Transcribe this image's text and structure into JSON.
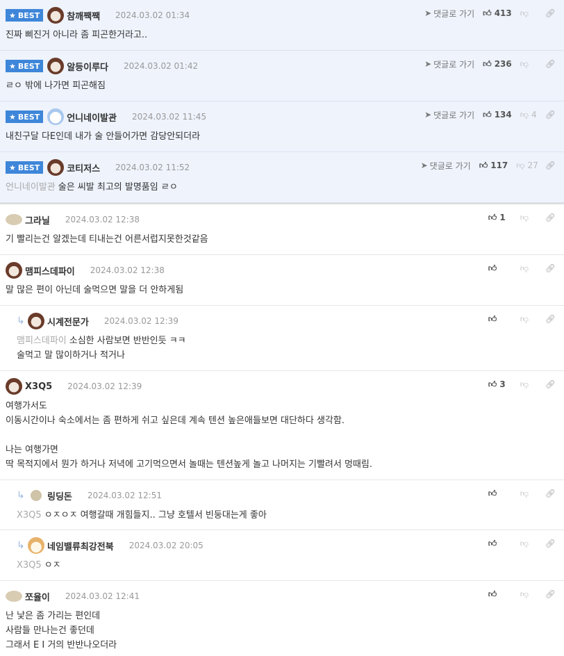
{
  "labels": {
    "best": "BEST",
    "goto_reply": "댓글로 가기"
  },
  "comments": [
    {
      "best": true,
      "nick": "참깨짹짹",
      "date": "2024.03.02 01:34",
      "likes": "413",
      "dislikes": "",
      "text": "진짜 삐진거 아니라 좀 피곤한거라고.."
    },
    {
      "best": true,
      "nick": "알등이루다",
      "date": "2024.03.02 01:42",
      "likes": "236",
      "dislikes": "",
      "text": "ㄹㅇ 밖에 나가면 피곤해짐"
    },
    {
      "best": true,
      "nick": "언니네이발관",
      "date": "2024.03.02 11:45",
      "likes": "134",
      "dislikes": "4",
      "text": "내친구달 다E인데 내가 술 안들어가면 감당안되더라"
    },
    {
      "best": true,
      "nick": "코티저스",
      "date": "2024.03.02 11:52",
      "likes": "117",
      "dislikes": "27",
      "mention": "언니네이발관",
      "text": "술은 씨발 최고의 발명품임 ㄹㅇ"
    },
    {
      "nick": "그라닐",
      "date": "2024.03.02 12:38",
      "likes": "1",
      "text": "기 빨리는건 알겠는데 티내는건 어른서럽지못한것같음"
    },
    {
      "nick": "맴피스데파이",
      "date": "2024.03.02 12:38",
      "likes": "",
      "text": "말 많은 편이 아닌데 술먹으면 말을 더 안하게됨"
    },
    {
      "reply": true,
      "nick": "시계전문가",
      "date": "2024.03.02 12:39",
      "likes": "",
      "mention": "맴피스데파이",
      "text": "소심한 사람보면 반반인듯 ㅋㅋ\n술먹고 말 많이하거나 적거나"
    },
    {
      "nick": "X3Q5",
      "date": "2024.03.02 12:39",
      "likes": "3",
      "text": "여행가서도\n이동시간이나 숙소에서는 좀 편하게 쉬고 싶은데 계속 텐션 높은애들보면 대단하다 생각함.\n\n나는 여행가면\n딱 목적지에서 뭔가 하거나 저녁에 고기먹으면서 놀때는 텐션높게 놀고 나머지는 기빨려서 멍때림."
    },
    {
      "reply": true,
      "nick": "링딩돈",
      "date": "2024.03.02 12:51",
      "likes": "",
      "mention": "X3Q5",
      "text": "ㅇㅈㅇㅈ 여행갈때 개힘들지.. 그냥 호텔서 빈둥대는게 좋아"
    },
    {
      "reply": true,
      "nick": "네임밸류최강전북",
      "date": "2024.03.02 20:05",
      "likes": "",
      "mention": "X3Q5",
      "text": "ㅇㅈ"
    },
    {
      "nick": "쪼율이",
      "date": "2024.03.02 12:41",
      "likes": "",
      "text": "난 낯은 좀 가리는 편인데\n사람들 만나는건 좋던데\n그래서 E I 거의 반반나오더라"
    }
  ]
}
